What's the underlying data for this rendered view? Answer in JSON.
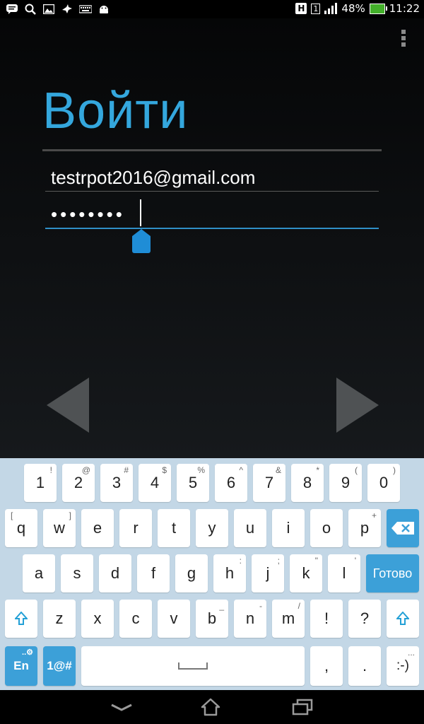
{
  "status_bar": {
    "battery_text": "48%",
    "time": "11:22",
    "network_type": "H",
    "sim_slot": "1",
    "icons_left": [
      "message-icon",
      "search-icon",
      "image-icon",
      "bird-icon",
      "keyboard-icon",
      "android-icon"
    ]
  },
  "login": {
    "title": "Войти",
    "email_value": "testrpot2016@gmail.com",
    "password_value": "••••••••"
  },
  "keyboard": {
    "row_numbers": [
      {
        "label": "1",
        "sub": "!"
      },
      {
        "label": "2",
        "sub": "@"
      },
      {
        "label": "3",
        "sub": "#"
      },
      {
        "label": "4",
        "sub": "$"
      },
      {
        "label": "5",
        "sub": "%"
      },
      {
        "label": "6",
        "sub": "^"
      },
      {
        "label": "7",
        "sub": "&"
      },
      {
        "label": "8",
        "sub": "*"
      },
      {
        "label": "9",
        "sub": "("
      },
      {
        "label": "0",
        "sub": ")"
      }
    ],
    "row_q": [
      {
        "label": "q",
        "sub": "["
      },
      {
        "label": "w",
        "sub": "]"
      },
      {
        "label": "e"
      },
      {
        "label": "r"
      },
      {
        "label": "t"
      },
      {
        "label": "y"
      },
      {
        "label": "u"
      },
      {
        "label": "i"
      },
      {
        "label": "o"
      },
      {
        "label": "p",
        "sub": "+"
      }
    ],
    "row_a": [
      {
        "label": "a"
      },
      {
        "label": "s"
      },
      {
        "label": "d"
      },
      {
        "label": "f"
      },
      {
        "label": "g"
      },
      {
        "label": "h",
        "sub": ":"
      },
      {
        "label": "j",
        "sub": ";"
      },
      {
        "label": "k",
        "sub": "\""
      },
      {
        "label": "l",
        "sub": "'"
      }
    ],
    "done_label": "Готово",
    "row_z": [
      {
        "label": "z"
      },
      {
        "label": "x"
      },
      {
        "label": "c"
      },
      {
        "label": "v"
      },
      {
        "label": "b",
        "sub": "_"
      },
      {
        "label": "n",
        "sub": "-"
      },
      {
        "label": "m",
        "sub": "/"
      },
      {
        "label": "!"
      },
      {
        "label": "?"
      }
    ],
    "lang_label": "En",
    "lang_sub": "..⚙",
    "symbols_label": "1@#",
    "comma_label": ",",
    "period_label": ".",
    "smiley_label": ":-)",
    "smiley_sub": "..."
  },
  "colors": {
    "accent": "#34a7dd",
    "keyboard_bg": "#c3d7e6",
    "key_blue": "#3ca0d8"
  }
}
